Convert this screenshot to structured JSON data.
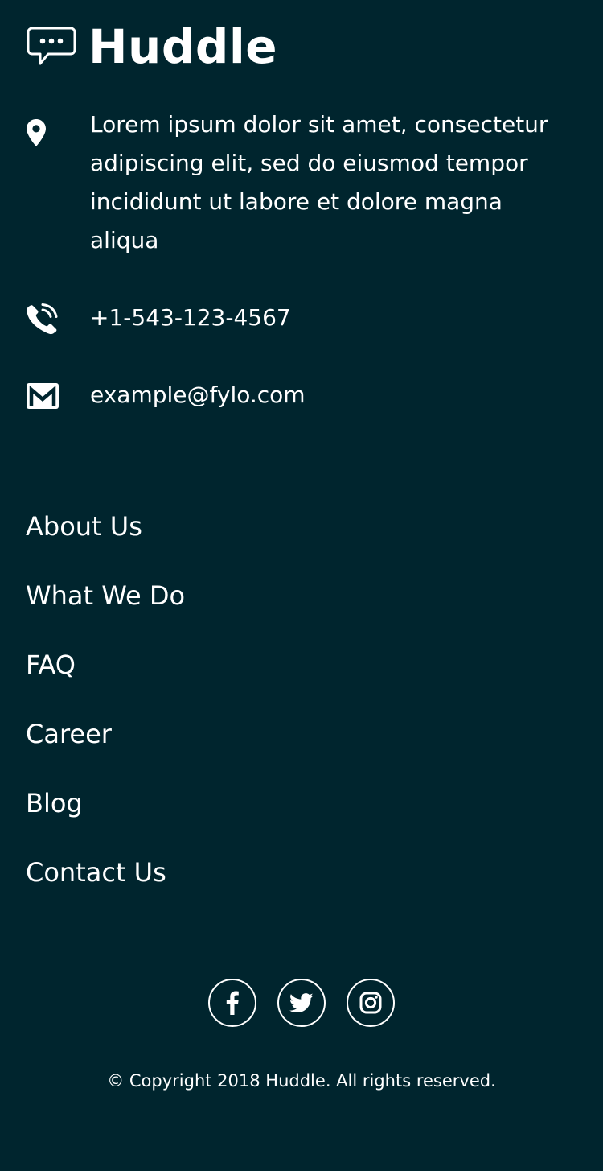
{
  "brand": {
    "name": "Huddle",
    "logo_icon": "chat-bubble-icon"
  },
  "contact": {
    "address": "Lorem ipsum dolor sit amet, consectetur adipiscing elit, sed do eiusmod tempor incididunt ut labore et dolore magna aliqua",
    "address_icon": "location-pin-icon",
    "phone": "+1-543-123-4567",
    "phone_icon": "phone-icon",
    "email": "example@fylo.com",
    "email_icon": "email-icon"
  },
  "nav": {
    "items": [
      {
        "label": "About Us"
      },
      {
        "label": "What We Do"
      },
      {
        "label": "FAQ"
      },
      {
        "label": "Career"
      },
      {
        "label": "Blog"
      },
      {
        "label": "Contact Us"
      }
    ]
  },
  "social": {
    "items": [
      {
        "icon": "facebook-icon"
      },
      {
        "icon": "twitter-icon"
      },
      {
        "icon": "instagram-icon"
      }
    ]
  },
  "copyright": "© Copyright 2018 Huddle. All rights reserved.",
  "colors": {
    "background": "#00252e",
    "text": "#ffffff"
  }
}
